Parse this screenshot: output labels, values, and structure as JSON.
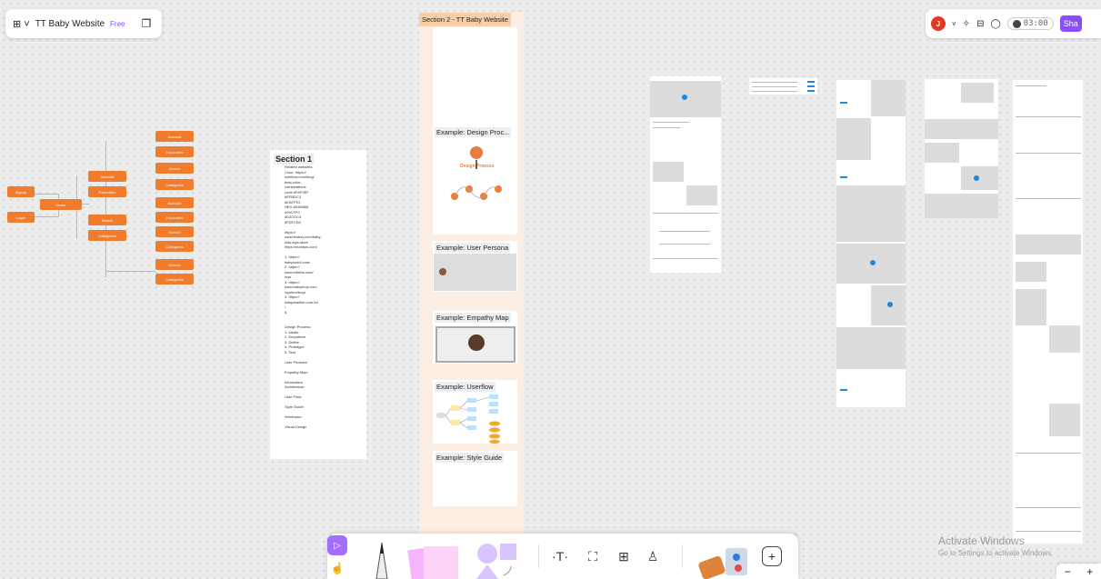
{
  "file": {
    "name": "TT Baby Website",
    "plan": "Free"
  },
  "toolbar_right": {
    "avatar_initial": "J",
    "timer": "03:00",
    "share_label": "Sha"
  },
  "mindmap": {
    "left_nodes": [
      "Signup",
      "Login"
    ],
    "home": "Home",
    "mid_nodes": [
      "Account",
      "Favourites",
      "Search",
      "Categories"
    ],
    "right_nodes": [
      "Account",
      "Favourites",
      "Search",
      "Categories",
      "Account",
      "Favourites",
      "Search",
      "Categories",
      "Search",
      "Categories"
    ]
  },
  "section1": {
    "title": "Section 1",
    "body": "Related websites\nColor: https://\nwebflow.com/blog/\nbest-color-\ncombinations\ncode:#FAF0EF\n#EFBDC3\n#EAFFE3\nHEX #D6948B\n#99CFF0\n#D3CDC4\n#FDFCE6\n\nhttps://\nwww.firstcry.com/baby-\nkids-toys-store\nhttps://mobbys.com/\n\n1. https://\nbabyhuddl.com/\n2. https://\nwww.ethetta.com/\ntoys\n3. https://\nwww.babyshop.com\n/system/boys\n4. https://\nkidsparadise.com.bd\n/\n5.\n\n\nDesign Process:\n1. Ideate\n2. Empathize\n3. Define\n4. Prototype\n5. Test\n\nUser Persona:\n\nEmpathy Map:\n\nInformation\nArchitecture:\n\nUser Flow:\n\nStyle Guide:\n\nWireframe:\n\nVisual Design"
  },
  "section2": {
    "label": "Section 2 - TT Baby Website",
    "cards": [
      {
        "title": "Example: Design Proc..."
      },
      {
        "title": "Example: User Persona"
      },
      {
        "title": "Example: Empathy Map"
      },
      {
        "title": "Example: Userflow"
      },
      {
        "title": "Example: Style Guide"
      }
    ],
    "design_process_heading": "Design Process"
  },
  "watermark": {
    "line1": "Activate Windows",
    "line2": "Go to Settings to activate Windows."
  },
  "zoom": {
    "out": "−",
    "in": "+"
  },
  "colors": {
    "accent": "#8a4dff",
    "node": "#f07c2e",
    "section_label": "#f6cfa9",
    "section_bg": "#fdeee4"
  }
}
